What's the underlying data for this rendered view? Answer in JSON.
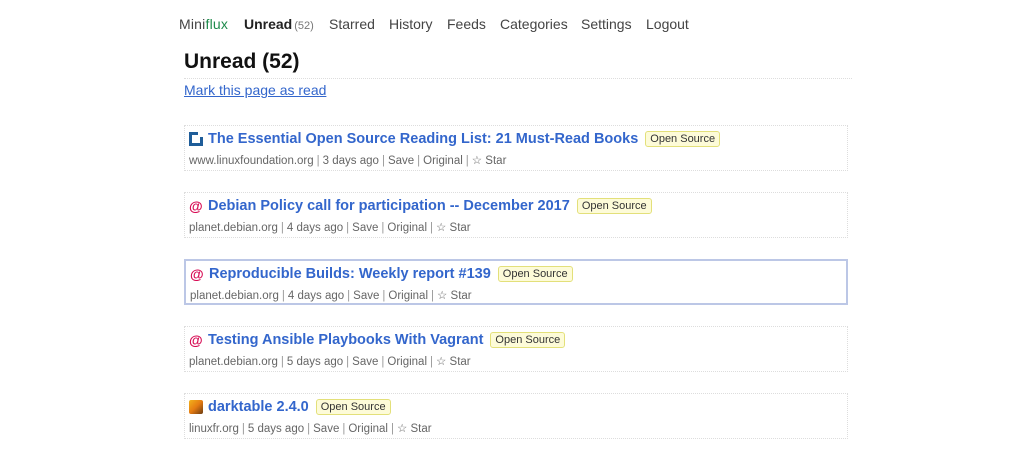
{
  "header": {
    "logo_prefix": "Mini",
    "logo_suffix": "flux",
    "nav": [
      {
        "label": "Unread",
        "count": "(52)"
      },
      {
        "label": "Starred"
      },
      {
        "label": "History"
      },
      {
        "label": "Feeds"
      },
      {
        "label": "Categories"
      },
      {
        "label": "Settings"
      },
      {
        "label": "Logout"
      }
    ]
  },
  "page": {
    "title": "Unread (52)",
    "mark_read": "Mark this page as read"
  },
  "items": [
    {
      "favicon": "linuxfoundation-icon",
      "title": "The Essential Open Source Reading List: 21 Must-Read Books",
      "tag": "Open Source",
      "domain": "www.linuxfoundation.org",
      "age": "3 days ago",
      "save": "Save",
      "original": "Original",
      "star": "☆ Star"
    },
    {
      "favicon": "debian-icon",
      "title": "Debian Policy call for participation -- December 2017",
      "tag": "Open Source",
      "domain": "planet.debian.org",
      "age": "4 days ago",
      "save": "Save",
      "original": "Original",
      "star": "☆ Star"
    },
    {
      "favicon": "debian-icon",
      "title": "Reproducible Builds: Weekly report #139",
      "tag": "Open Source",
      "domain": "planet.debian.org",
      "age": "4 days ago",
      "save": "Save",
      "original": "Original",
      "star": "☆ Star"
    },
    {
      "favicon": "debian-icon",
      "title": "Testing Ansible Playbooks With Vagrant",
      "tag": "Open Source",
      "domain": "planet.debian.org",
      "age": "5 days ago",
      "save": "Save",
      "original": "Original",
      "star": "☆ Star"
    },
    {
      "favicon": "darktable-icon",
      "title": "darktable 2.4.0",
      "tag": "Open Source",
      "domain": "linuxfr.org",
      "age": "5 days ago",
      "save": "Save",
      "original": "Original",
      "star": "☆ Star"
    }
  ]
}
